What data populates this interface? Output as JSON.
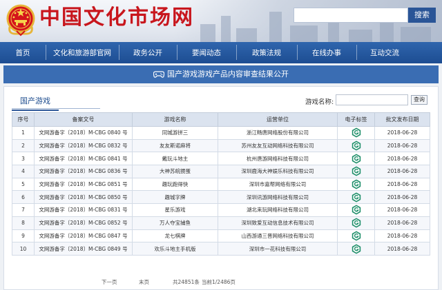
{
  "header": {
    "site_title": "中国文化市场网",
    "search_placeholder": "",
    "search_button": "搜索"
  },
  "nav": {
    "items": [
      {
        "label": "首页"
      },
      {
        "label": "文化和旅游部官网"
      },
      {
        "label": "政务公开"
      },
      {
        "label": "要闻动态"
      },
      {
        "label": "政策法规"
      },
      {
        "label": "在线办事"
      },
      {
        "label": "互动交流"
      }
    ]
  },
  "banner": {
    "title": "国产游戏游戏产品内容审查结果公开"
  },
  "section": {
    "tab_label": "国产游戏",
    "filter_label": "游戏名称:",
    "filter_value": "",
    "filter_button": "查询"
  },
  "table": {
    "headers": [
      "序号",
      "备案文号",
      "游戏名称",
      "运营单位",
      "电子标签",
      "批文发布日期"
    ],
    "rows": [
      {
        "no": "1",
        "doc": "文网游备字〔2018〕M-CBG 0840 号",
        "name": "同城游拼三",
        "operator": "浙江畅唐网络股份有限公司",
        "date": "2018-06-28"
      },
      {
        "no": "2",
        "doc": "文网游备字〔2018〕M-CBG 0832 号",
        "name": "友友斯诺麻将",
        "operator": "苏州友友互动网络科技有限公司",
        "date": "2018-06-28"
      },
      {
        "no": "3",
        "doc": "文网游备字〔2018〕M-CBG 0841 号",
        "name": "戴玩斗地主",
        "operator": "杭州唐游网络科技有限公司",
        "date": "2018-06-28"
      },
      {
        "no": "4",
        "doc": "文网游备字〔2018〕M-CBG 0836 号",
        "name": "大神苏皖掼蛋",
        "operator": "深圳鹿海大神娱乐科技有限公司",
        "date": "2018-06-28"
      },
      {
        "no": "5",
        "doc": "文网游备字〔2018〕M-CBG 0851 号",
        "name": "趣玩跑得快",
        "operator": "深圳市嘉帮网络有限公司",
        "date": "2018-06-28"
      },
      {
        "no": "6",
        "doc": "文网游备字〔2018〕M-CBG 0850 号",
        "name": "趣城字牌",
        "operator": "深圳讯游网络科技有限公司",
        "date": "2018-06-28"
      },
      {
        "no": "7",
        "doc": "文网游备字〔2018〕M-CBG 0831 号",
        "name": "星乐游戏",
        "operator": "湖北来玩网络科技有限公司",
        "date": "2018-06-28"
      },
      {
        "no": "8",
        "doc": "文网游备字〔2018〕M-CBG 0852 号",
        "name": "万人夺宝捕鱼",
        "operator": "深圳致爱互动信息技术有限公司",
        "date": "2018-06-28"
      },
      {
        "no": "9",
        "doc": "文网游备字〔2018〕M-CBG 0847 号",
        "name": "龙七棋牌",
        "operator": "山西游通三晋网络科技有限公司",
        "date": "2018-06-28"
      },
      {
        "no": "10",
        "doc": "文网游备字〔2018〕M-CBG 0849 号",
        "name": "欢乐斗地主手机版",
        "operator": "深圳市一花科技有限公司",
        "date": "2018-06-28"
      }
    ]
  },
  "pager": {
    "next": "下一页",
    "last": "末页",
    "total": "共24851条",
    "page_info": "当前1/2486页"
  },
  "colors": {
    "brand_red": "#c8161d",
    "nav_blue": "#2a5597",
    "badge_green": "#1f8f6a"
  }
}
